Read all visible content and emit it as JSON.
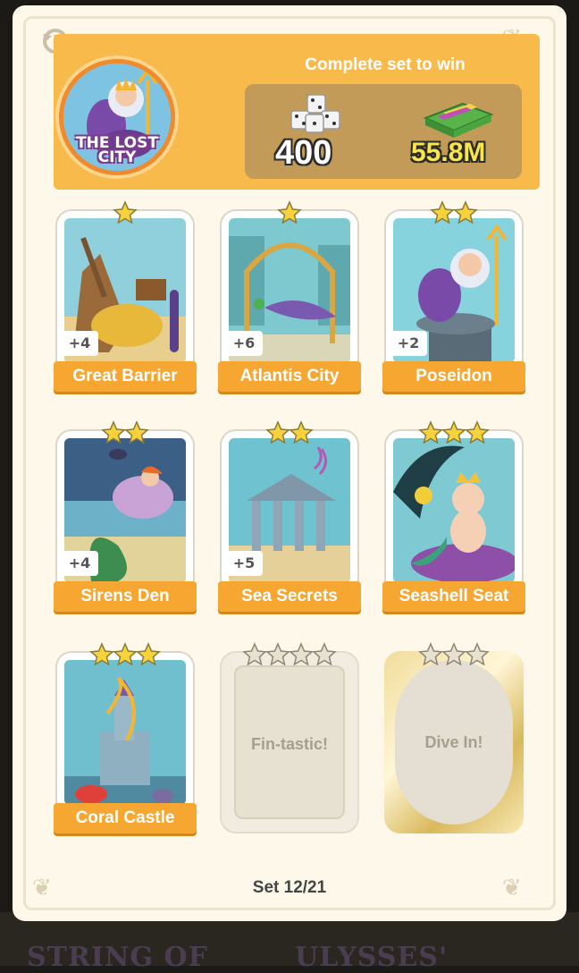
{
  "header": {
    "album_name": "THE LOST CITY",
    "complete_text": "Complete set to win",
    "rewards": [
      {
        "icon": "dice-icon",
        "value": "400"
      },
      {
        "icon": "cash-stack-icon",
        "value": "55.8M"
      }
    ]
  },
  "cards": [
    {
      "name": "Great Barrier",
      "stars": 1,
      "count": "+4",
      "state": "owned"
    },
    {
      "name": "Atlantis City",
      "stars": 1,
      "count": "+6",
      "state": "owned"
    },
    {
      "name": "Poseidon",
      "stars": 2,
      "count": "+2",
      "state": "owned"
    },
    {
      "name": "Sirens Den",
      "stars": 2,
      "count": "+4",
      "state": "owned"
    },
    {
      "name": "Sea Secrets",
      "stars": 2,
      "count": "+5",
      "state": "owned"
    },
    {
      "name": "Seashell Seat",
      "stars": 3,
      "count": "",
      "state": "owned"
    },
    {
      "name": "Coral Castle",
      "stars": 3,
      "count": "",
      "state": "owned"
    },
    {
      "name": "Fin-tastic!",
      "stars": 4,
      "count": "",
      "state": "locked"
    },
    {
      "name": "Dive In!",
      "stars": 3,
      "count": "",
      "state": "locked-gold"
    }
  ],
  "set_label": "Set 12/21",
  "background_text": [
    "STRING OF",
    "ULYSSES'"
  ],
  "colors": {
    "header": "#f8bb4b",
    "ribbon": "#f6a732",
    "star": "#f7d23b",
    "panel": "#fdf8ea"
  }
}
